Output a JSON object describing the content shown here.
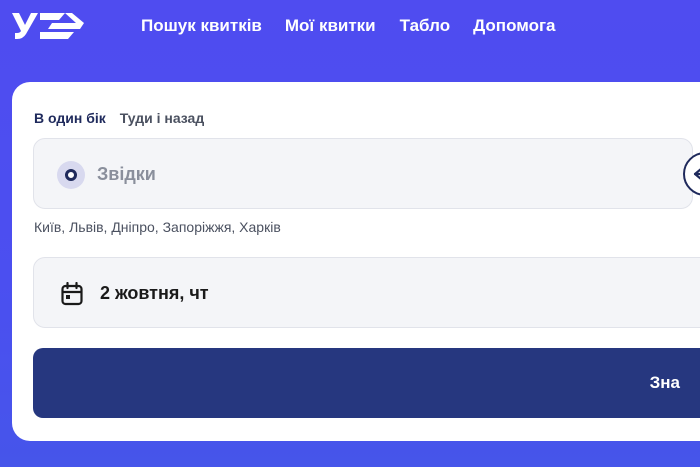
{
  "brand": {
    "logo_text": "УЗ",
    "accent_color": "#4f4cf0",
    "button_color": "#26377f"
  },
  "nav": {
    "items": [
      {
        "label": "Пошук квитків"
      },
      {
        "label": "Мої квитки"
      },
      {
        "label": "Табло"
      },
      {
        "label": "Допомога"
      }
    ]
  },
  "trip_type": {
    "one_way_label": "В один бік",
    "round_trip_label": "Туди і назад",
    "selected": "one_way"
  },
  "from": {
    "placeholder": "Звідки",
    "value": ""
  },
  "suggestions": {
    "text": "Київ, Львів, Дніпро, Запоріжжя, Харків"
  },
  "date": {
    "value": "2 жовтня, чт"
  },
  "search": {
    "label": "Зна"
  },
  "icons": {
    "from": "origin-point-icon",
    "swap": "swap-arrows-icon",
    "calendar": "calendar-icon"
  }
}
